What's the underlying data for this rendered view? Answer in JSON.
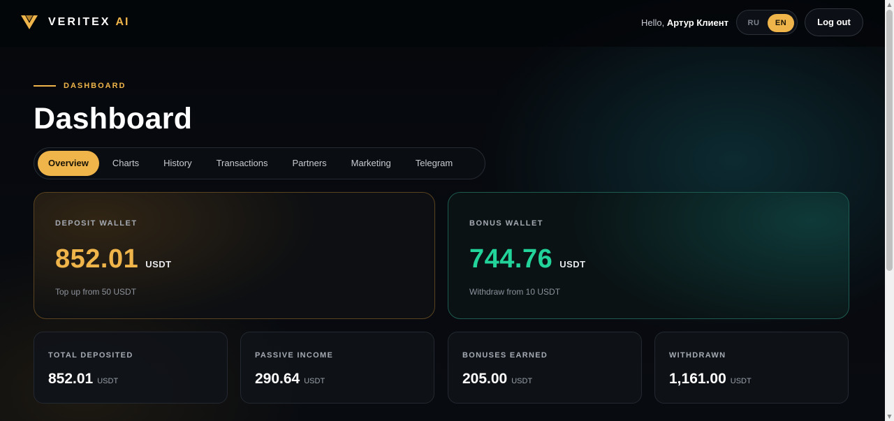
{
  "brand": {
    "name": "VERITEX",
    "suffix": "AI",
    "logo_icon": "veritex-v-logo-icon",
    "accent": "#f0b54a"
  },
  "header": {
    "greeting": "Hello,",
    "user_name": "Артур Клиент",
    "languages": [
      "RU",
      "EN"
    ],
    "active_language": "EN",
    "logout_label": "Log out"
  },
  "page": {
    "eyebrow": "DASHBOARD",
    "title": "Dashboard"
  },
  "tabs": [
    {
      "label": "Overview",
      "active": true
    },
    {
      "label": "Charts",
      "active": false
    },
    {
      "label": "History",
      "active": false
    },
    {
      "label": "Transactions",
      "active": false
    },
    {
      "label": "Partners",
      "active": false
    },
    {
      "label": "Marketing",
      "active": false
    },
    {
      "label": "Telegram",
      "active": false
    }
  ],
  "wallets": {
    "deposit": {
      "label": "DEPOSIT WALLET",
      "amount": "852.01",
      "unit": "USDT",
      "note": "Top up from 50 USDT",
      "color": "#f0b54a"
    },
    "bonus": {
      "label": "BONUS WALLET",
      "amount": "744.76",
      "unit": "USDT",
      "note": "Withdraw from 10 USDT",
      "color": "#22d39a"
    }
  },
  "stats": [
    {
      "label": "TOTAL DEPOSITED",
      "value": "852.01",
      "unit": "USDT"
    },
    {
      "label": "PASSIVE INCOME",
      "value": "290.64",
      "unit": "USDT"
    },
    {
      "label": "BONUSES EARNED",
      "value": "205.00",
      "unit": "USDT"
    },
    {
      "label": "WITHDRAWN",
      "value": "1,161.00",
      "unit": "USDT"
    }
  ],
  "scrollbar": {
    "up_icon": "scroll-up-arrow-icon",
    "down_icon": "scroll-down-arrow-icon"
  }
}
